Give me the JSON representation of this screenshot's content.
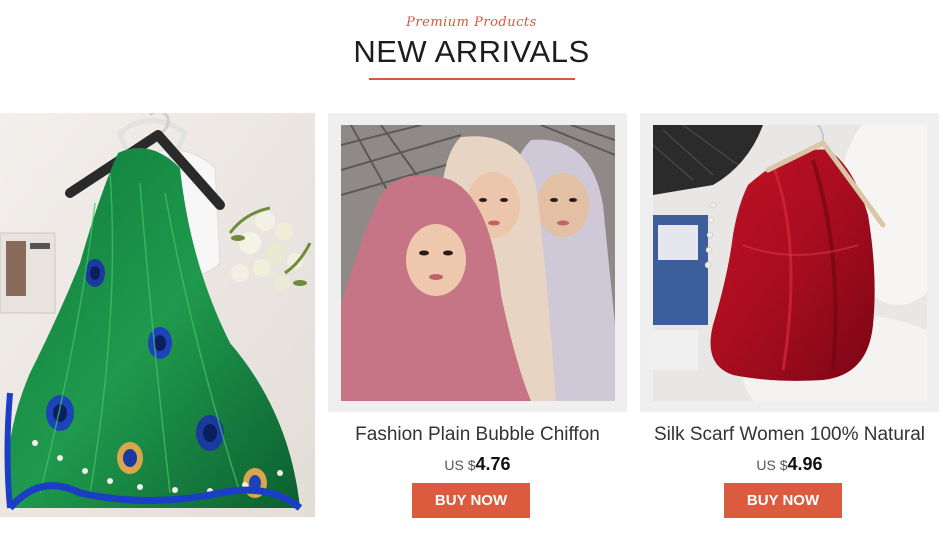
{
  "header": {
    "subtitle": "Premium Products",
    "title": "NEW ARRIVALS"
  },
  "colors": {
    "accent": "#dc5a3e",
    "title_text": "#1d1d1d",
    "card_frame": "#efefef"
  },
  "hero": {
    "image_icon": "peacock-scarf-photo"
  },
  "products": [
    {
      "name": "Fashion Plain Bubble Chiffon",
      "currency": "US $",
      "price": "4.76",
      "button_label": "BUY NOW",
      "image_icon": "chiffon-hijab-photo"
    },
    {
      "name": "Silk Scarf Women 100% Natural",
      "currency": "US $",
      "price": "4.96",
      "button_label": "BUY NOW",
      "image_icon": "red-silk-scarf-photo"
    }
  ]
}
